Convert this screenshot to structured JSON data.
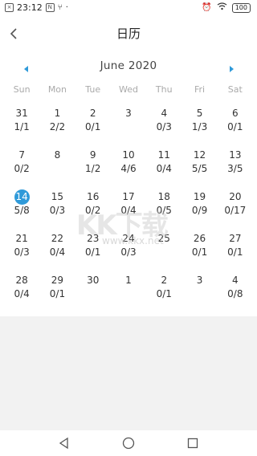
{
  "status_bar": {
    "time": "23:12",
    "battery": "100",
    "left_icons": [
      "sim-icon",
      "n-icon",
      "usb-icon",
      "dot-icon"
    ],
    "right_icons": [
      "alarm-icon",
      "wifi-icon",
      "battery-icon"
    ]
  },
  "header": {
    "title": "日历"
  },
  "calendar": {
    "month_label": "June 2020",
    "weekdays": [
      "Sun",
      "Mon",
      "Tue",
      "Wed",
      "Thu",
      "Fri",
      "Sat"
    ],
    "weeks": [
      [
        {
          "day": "31",
          "count": "1/1"
        },
        {
          "day": "1",
          "count": "2/2"
        },
        {
          "day": "2",
          "count": "0/1"
        },
        {
          "day": "3",
          "count": ""
        },
        {
          "day": "4",
          "count": "0/3"
        },
        {
          "day": "5",
          "count": "1/3"
        },
        {
          "day": "6",
          "count": "0/1"
        }
      ],
      [
        {
          "day": "7",
          "count": "0/2"
        },
        {
          "day": "8",
          "count": ""
        },
        {
          "day": "9",
          "count": "1/2"
        },
        {
          "day": "10",
          "count": "4/6"
        },
        {
          "day": "11",
          "count": "0/4"
        },
        {
          "day": "12",
          "count": "5/5"
        },
        {
          "day": "13",
          "count": "3/5"
        }
      ],
      [
        {
          "day": "14",
          "count": "5/8",
          "selected": true
        },
        {
          "day": "15",
          "count": "0/3"
        },
        {
          "day": "16",
          "count": "0/2"
        },
        {
          "day": "17",
          "count": "0/4"
        },
        {
          "day": "18",
          "count": "0/5"
        },
        {
          "day": "19",
          "count": "0/9"
        },
        {
          "day": "20",
          "count": "0/17"
        }
      ],
      [
        {
          "day": "21",
          "count": "0/3"
        },
        {
          "day": "22",
          "count": "0/4"
        },
        {
          "day": "23",
          "count": "0/1"
        },
        {
          "day": "24",
          "count": "0/3"
        },
        {
          "day": "25",
          "count": ""
        },
        {
          "day": "26",
          "count": "0/1"
        },
        {
          "day": "27",
          "count": "0/1"
        }
      ],
      [
        {
          "day": "28",
          "count": "0/4"
        },
        {
          "day": "29",
          "count": "0/1"
        },
        {
          "day": "30",
          "count": ""
        },
        {
          "day": "1",
          "count": ""
        },
        {
          "day": "2",
          "count": "0/1"
        },
        {
          "day": "3",
          "count": ""
        },
        {
          "day": "4",
          "count": "0/8"
        }
      ]
    ]
  },
  "accent_color": "#2f9ad9",
  "watermark": {
    "main": "KK下载",
    "sub": "www.kkx.net"
  }
}
